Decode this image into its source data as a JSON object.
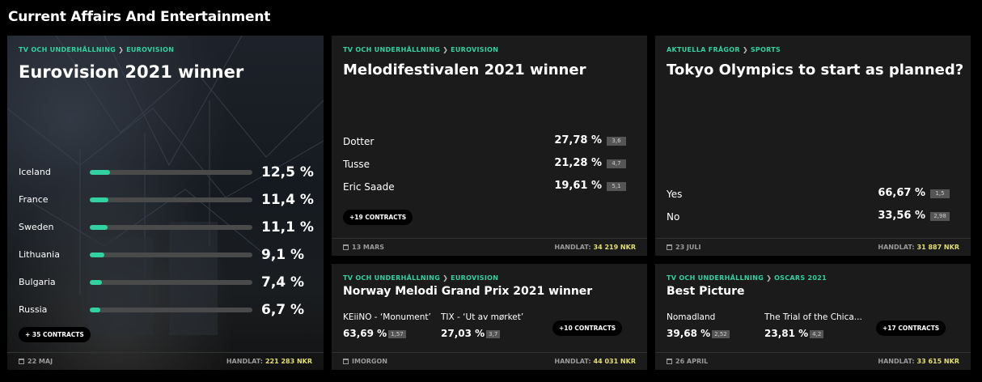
{
  "section_title": "Current Affairs And Entertainment",
  "colors": {
    "accent": "#2fd2a0",
    "amount": "#e6df72",
    "card": "#1b1b1b"
  },
  "cards": {
    "eurovision": {
      "crumb_a": "TV OCH UNDERHÅLLNING",
      "crumb_b": "EUROVISION",
      "title": "Eurovision 2021 winner",
      "rows": [
        {
          "name": "Iceland",
          "pct": "12,5 %",
          "fraction": 0.125
        },
        {
          "name": "France",
          "pct": "11,4 %",
          "fraction": 0.114
        },
        {
          "name": "Sweden",
          "pct": "11,1 %",
          "fraction": 0.111
        },
        {
          "name": "Lithuania",
          "pct": "9,1 %",
          "fraction": 0.091
        },
        {
          "name": "Bulgaria",
          "pct": "7,4 %",
          "fraction": 0.074
        },
        {
          "name": "Russia",
          "pct": "6,7 %",
          "fraction": 0.067
        }
      ],
      "more": "+ 35 CONTRACTS",
      "date": "22 MAJ",
      "traded_label": "HANDLAT:",
      "traded_amount": "221 283 NKR"
    },
    "melodifestivalen": {
      "crumb_a": "TV OCH UNDERHÅLLNING",
      "crumb_b": "EUROVISION",
      "title": "Melodifestivalen 2021 winner",
      "rows": [
        {
          "name": "Dotter",
          "pct": "27,78 %",
          "odds": "3,6"
        },
        {
          "name": "Tusse",
          "pct": "21,28 %",
          "odds": "4,7"
        },
        {
          "name": "Eric Saade",
          "pct": "19,61 %",
          "odds": "5,1"
        }
      ],
      "more": "+19 CONTRACTS",
      "date": "13 MARS",
      "traded_label": "HANDLAT:",
      "traded_amount": "34 219 NKR"
    },
    "olympics": {
      "crumb_a": "AKTUELLA FRÅGOR",
      "crumb_b": "SPORTS",
      "title": "Tokyo Olympics to start as planned?",
      "rows": [
        {
          "name": "Yes",
          "pct": "66,67 %",
          "odds": "1,5"
        },
        {
          "name": "No",
          "pct": "33,56 %",
          "odds": "2,98"
        }
      ],
      "date": "23 JULI",
      "traded_label": "HANDLAT:",
      "traded_amount": "31 887 NKR"
    },
    "mgp": {
      "crumb_a": "TV OCH UNDERHÅLLNING",
      "crumb_b": "EUROVISION",
      "title": "Norway Melodi Grand Prix 2021 winner",
      "options": [
        {
          "name": "KEiiNO - ‘Monument’",
          "pct": "63,69 %",
          "odds": "1,57"
        },
        {
          "name": "TIX - ‘Ut av mørket’",
          "pct": "27,03 %",
          "odds": "3,7"
        }
      ],
      "more": "+10 CONTRACTS",
      "date": "IMORGON",
      "traded_label": "HANDLAT:",
      "traded_amount": "44 031 NKR"
    },
    "oscars": {
      "crumb_a": "TV OCH UNDERHÅLLNING",
      "crumb_b": "OSCARS 2021",
      "title": "Best Picture",
      "options": [
        {
          "name": "Nomadland",
          "pct": "39,68 %",
          "odds": "2,52"
        },
        {
          "name": "The Trial of the Chica...",
          "pct": "23,81 %",
          "odds": "4,2"
        }
      ],
      "more": "+17 CONTRACTS",
      "date": "26 APRIL",
      "traded_label": "HANDLAT:",
      "traded_amount": "33 615 NKR"
    }
  }
}
